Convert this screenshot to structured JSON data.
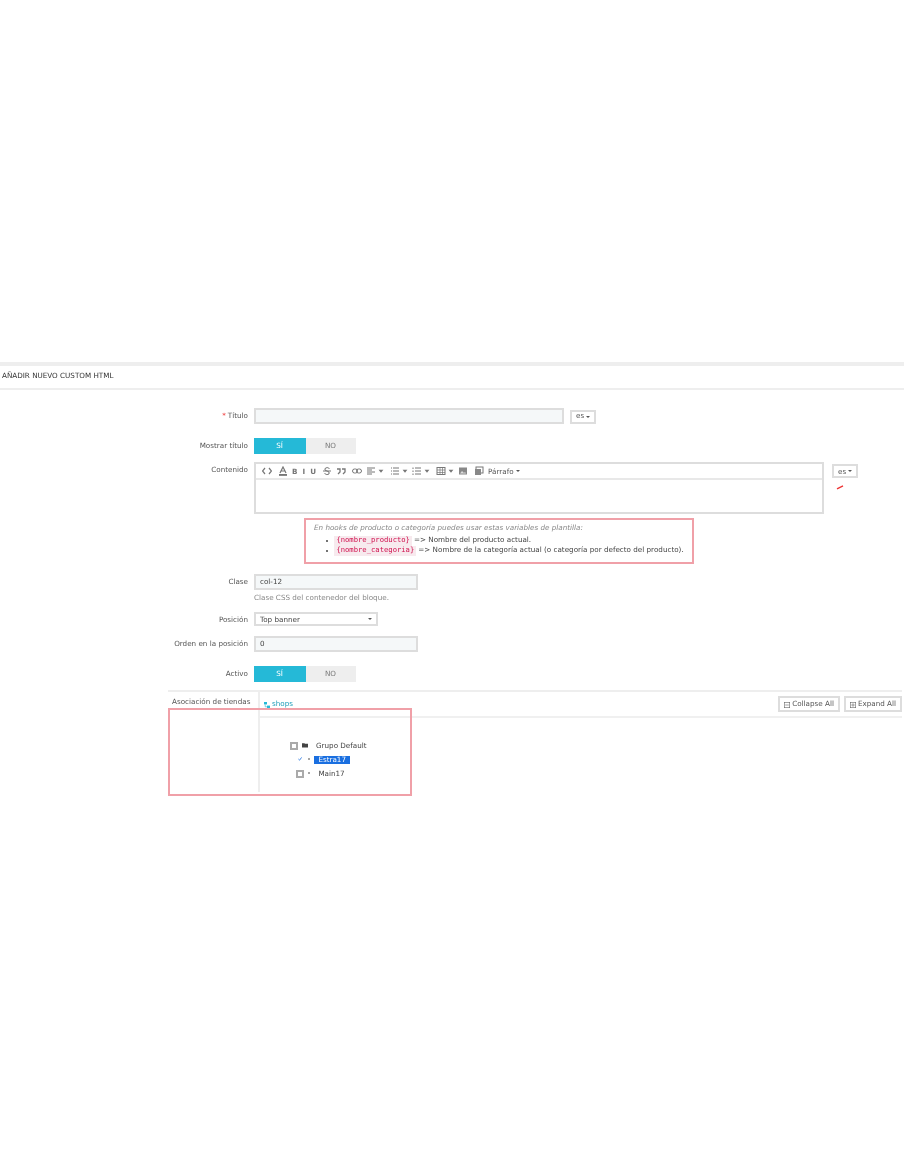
{
  "panel": {
    "title": "AÑADIR NUEVO CUSTOM HTML"
  },
  "form": {
    "title_field": {
      "label": "Título",
      "required_mark": "*",
      "lang": "es"
    },
    "show_title": {
      "label": "Mostrar título",
      "options": [
        {
          "label": "SÍ",
          "selected": true
        },
        {
          "label": "NO",
          "selected": false
        }
      ]
    },
    "content": {
      "label": "Contenido",
      "lang": "es",
      "toolbar": [
        {
          "kind": "code"
        },
        {
          "kind": "color"
        },
        {
          "kind": "text",
          "text": "B"
        },
        {
          "kind": "text",
          "text": "I"
        },
        {
          "kind": "text",
          "text": "U"
        },
        {
          "kind": "strike"
        },
        {
          "kind": "quote"
        },
        {
          "kind": "link"
        },
        {
          "kind": "align"
        },
        {
          "kind": "bullets"
        },
        {
          "kind": "numbers"
        },
        {
          "kind": "table"
        },
        {
          "kind": "image"
        },
        {
          "kind": "media"
        },
        {
          "kind": "menu",
          "text": "Párrafo"
        }
      ],
      "hint": "En hooks de producto o categoría puedes usar estas variables de plantilla:",
      "variables": [
        {
          "code": "{nombre_producto}",
          "text": "=> Nombre del producto actual."
        },
        {
          "code": "{nombre_categoria}",
          "text": "=> Nombre de la categoría actual (o categoría por defecto del producto)."
        }
      ]
    },
    "class_field": {
      "label": "Clase",
      "value": "col-12",
      "help": "Clase CSS del contenedor del bloque."
    },
    "position": {
      "label": "Posición",
      "value": "Top banner"
    },
    "order": {
      "label": "Orden en la posición",
      "value": "0"
    },
    "active": {
      "label": "Activo",
      "options": [
        {
          "label": "SÍ",
          "selected": true
        },
        {
          "label": "NO",
          "selected": false
        }
      ]
    },
    "shops": {
      "label": "Asociación de tiendas",
      "link": "shops",
      "buttons": [
        "Collapse All",
        "Expand All"
      ],
      "tree": [
        {
          "label": "Grupo Default",
          "checked": false,
          "selected": false,
          "children": [
            {
              "label": "Estra17",
              "checked": true,
              "selected": true
            },
            {
              "label": "Main17",
              "checked": false,
              "selected": false
            }
          ]
        }
      ]
    }
  }
}
